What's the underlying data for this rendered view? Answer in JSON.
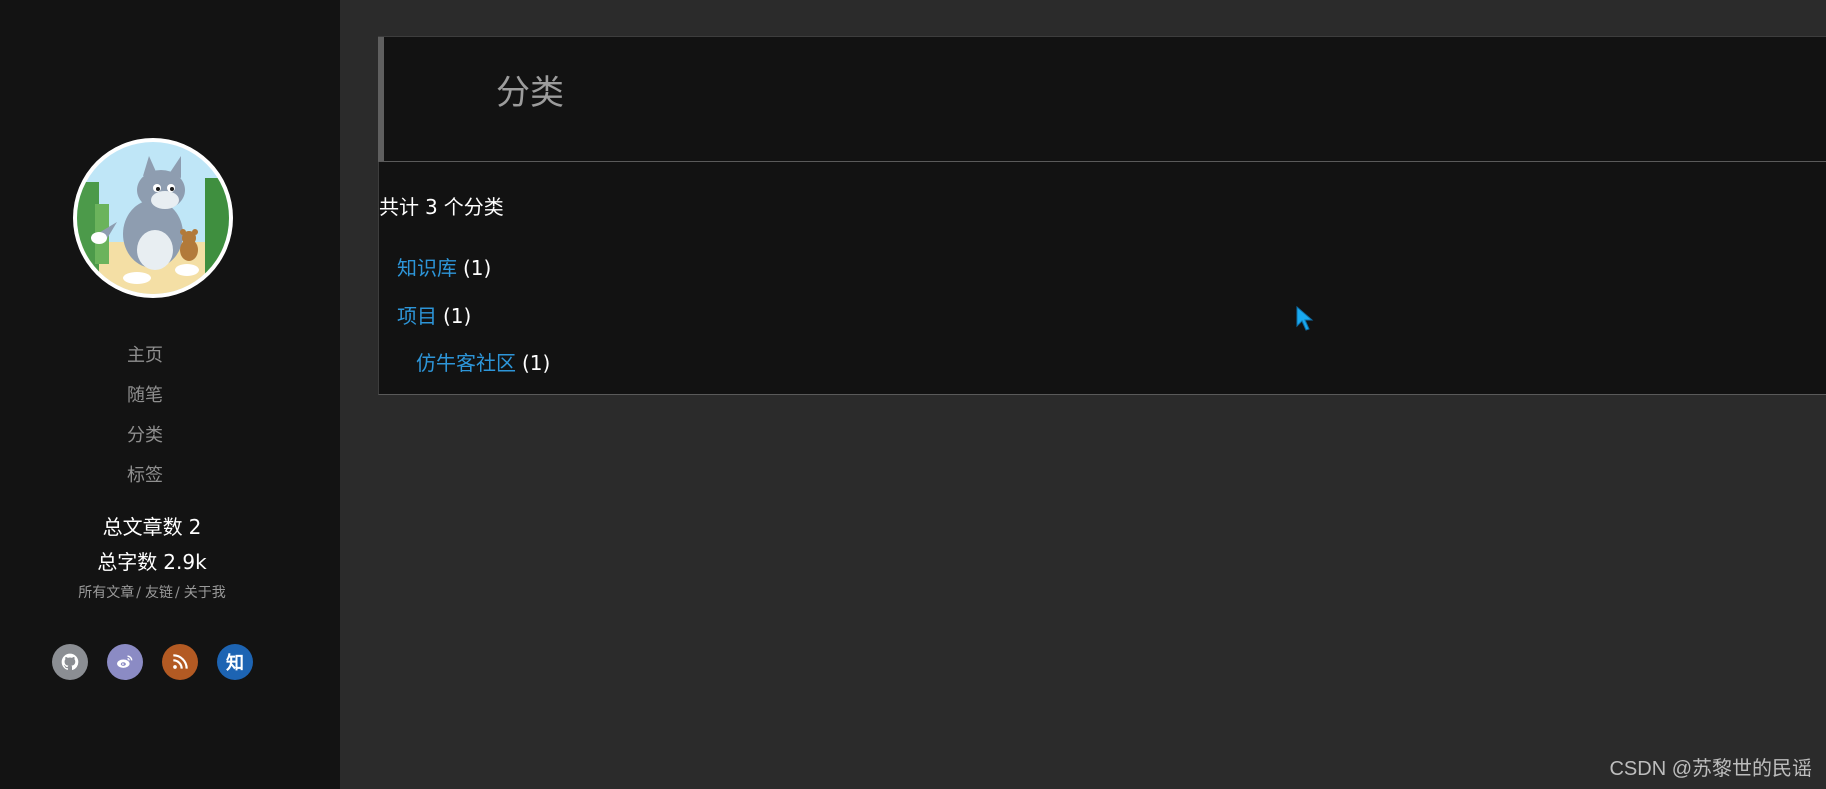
{
  "nav": {
    "items": [
      {
        "label": "主页"
      },
      {
        "label": "随笔"
      },
      {
        "label": "分类"
      },
      {
        "label": "标签"
      }
    ]
  },
  "stats": {
    "articles_label": "总文章数",
    "articles_value": "2",
    "words_label": "总字数",
    "words_value": "2.9k"
  },
  "links": {
    "all_posts": "所有文章",
    "friends": "友链",
    "about": "关于我",
    "separator": "/"
  },
  "socials": [
    {
      "icon": "github-icon",
      "color": "#8b8e93"
    },
    {
      "icon": "weibo-icon",
      "color": "#8b8bc4"
    },
    {
      "icon": "rss-icon",
      "color": "#b35a23"
    },
    {
      "icon": "zhihu-icon",
      "label": "知",
      "color": "#1d64b3"
    }
  ],
  "page": {
    "title": "分类"
  },
  "categories": {
    "summary_prefix": "共计",
    "summary_count": "3",
    "summary_suffix": "个分类",
    "items": [
      {
        "name": "知识库",
        "count": "(1)"
      },
      {
        "name": "项目",
        "count": "(1)"
      },
      {
        "name": "仿牛客社区",
        "count": "(1)",
        "level": 2
      }
    ]
  },
  "colors": {
    "link": "#2d95d8",
    "sidebar_bg": "#131313",
    "page_bg": "#2b2b2b",
    "panel_bg": "#121212"
  },
  "watermark": "CSDN @苏黎世的民谣"
}
